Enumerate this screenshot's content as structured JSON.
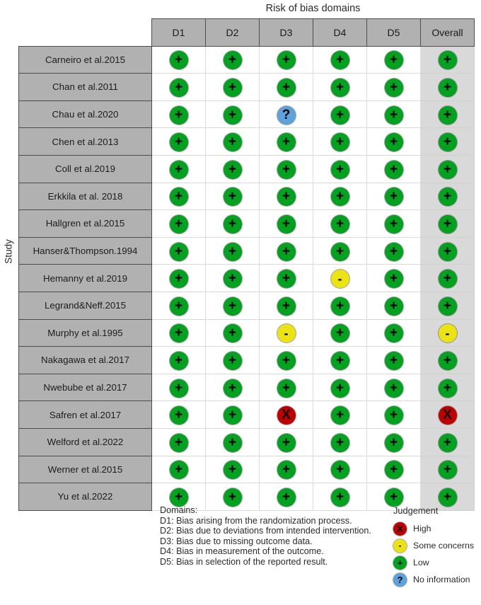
{
  "title": "Risk of bias domains",
  "axis_label_y": "Study",
  "columns": [
    "D1",
    "D2",
    "D3",
    "D4",
    "D5",
    "Overall"
  ],
  "corner_label": "",
  "domains_key": {
    "heading": "Domains:",
    "lines": [
      "D1: Bias arising from the randomization process.",
      "D2: Bias due to deviations from intended intervention.",
      "D3: Bias due to missing outcome data.",
      "D4: Bias in measurement of the outcome.",
      "D5: Bias in selection of the reported result."
    ]
  },
  "judgement_legend": {
    "title": "Judgement",
    "items": [
      {
        "key": "high",
        "glyph": "X",
        "label": "High",
        "color": "#bf0000"
      },
      {
        "key": "some",
        "glyph": "-",
        "label": "Some concerns",
        "color": "#ece313"
      },
      {
        "key": "low",
        "glyph": "+",
        "label": "Low",
        "color": "#02a11f"
      },
      {
        "key": "none",
        "glyph": "?",
        "label": "No information",
        "color": "#5ea2dd"
      }
    ]
  },
  "glyphs": {
    "low": "+",
    "some": "-",
    "high": "X",
    "none": "?"
  },
  "colors": {
    "low": "#02a11f",
    "some": "#ece313",
    "high": "#bf0000",
    "none": "#5ea2dd",
    "header_bg": "#b1b1b1",
    "study_bg": "#b1b1b1",
    "overall_bg": "#d9d9d9",
    "cell_bg": "#ffffff",
    "grid_line": "#4d4d4d"
  },
  "chart_data": {
    "type": "heatmap",
    "title": "Risk of bias domains",
    "xlabel": "",
    "ylabel": "Study",
    "grid": true,
    "legend_position": "bottom-right",
    "categories_x": [
      "D1",
      "D2",
      "D3",
      "D4",
      "D5",
      "Overall"
    ],
    "value_scale": [
      "low",
      "some",
      "high",
      "none"
    ],
    "rows": [
      {
        "study": "Carneiro et al.2015",
        "values": [
          "low",
          "low",
          "low",
          "low",
          "low",
          "low"
        ]
      },
      {
        "study": "Chan et al.2011",
        "values": [
          "low",
          "low",
          "low",
          "low",
          "low",
          "low"
        ]
      },
      {
        "study": "Chau et al.2020",
        "values": [
          "low",
          "low",
          "none",
          "low",
          "low",
          "low"
        ]
      },
      {
        "study": "Chen et al.2013",
        "values": [
          "low",
          "low",
          "low",
          "low",
          "low",
          "low"
        ]
      },
      {
        "study": "Coll et al.2019",
        "values": [
          "low",
          "low",
          "low",
          "low",
          "low",
          "low"
        ]
      },
      {
        "study": "Erkkila et al. 2018",
        "values": [
          "low",
          "low",
          "low",
          "low",
          "low",
          "low"
        ]
      },
      {
        "study": "Hallgren et al.2015",
        "values": [
          "low",
          "low",
          "low",
          "low",
          "low",
          "low"
        ]
      },
      {
        "study": "Hanser&Thompson.1994",
        "values": [
          "low",
          "low",
          "low",
          "low",
          "low",
          "low"
        ]
      },
      {
        "study": "Hemanny et al.2019",
        "values": [
          "low",
          "low",
          "low",
          "some",
          "low",
          "low"
        ]
      },
      {
        "study": "Legrand&Neff.2015",
        "values": [
          "low",
          "low",
          "low",
          "low",
          "low",
          "low"
        ]
      },
      {
        "study": "Murphy et al.1995",
        "values": [
          "low",
          "low",
          "some",
          "low",
          "low",
          "some"
        ]
      },
      {
        "study": "Nakagawa et al.2017",
        "values": [
          "low",
          "low",
          "low",
          "low",
          "low",
          "low"
        ]
      },
      {
        "study": "Nwebube et al.2017",
        "values": [
          "low",
          "low",
          "low",
          "low",
          "low",
          "low"
        ]
      },
      {
        "study": "Safren et al.2017",
        "values": [
          "low",
          "low",
          "high",
          "low",
          "low",
          "high"
        ]
      },
      {
        "study": "Welford et al.2022",
        "values": [
          "low",
          "low",
          "low",
          "low",
          "low",
          "low"
        ]
      },
      {
        "study": "Werner et al.2015",
        "values": [
          "low",
          "low",
          "low",
          "low",
          "low",
          "low"
        ]
      },
      {
        "study": "Yu et al.2022",
        "values": [
          "low",
          "low",
          "low",
          "low",
          "low",
          "low"
        ]
      }
    ]
  }
}
